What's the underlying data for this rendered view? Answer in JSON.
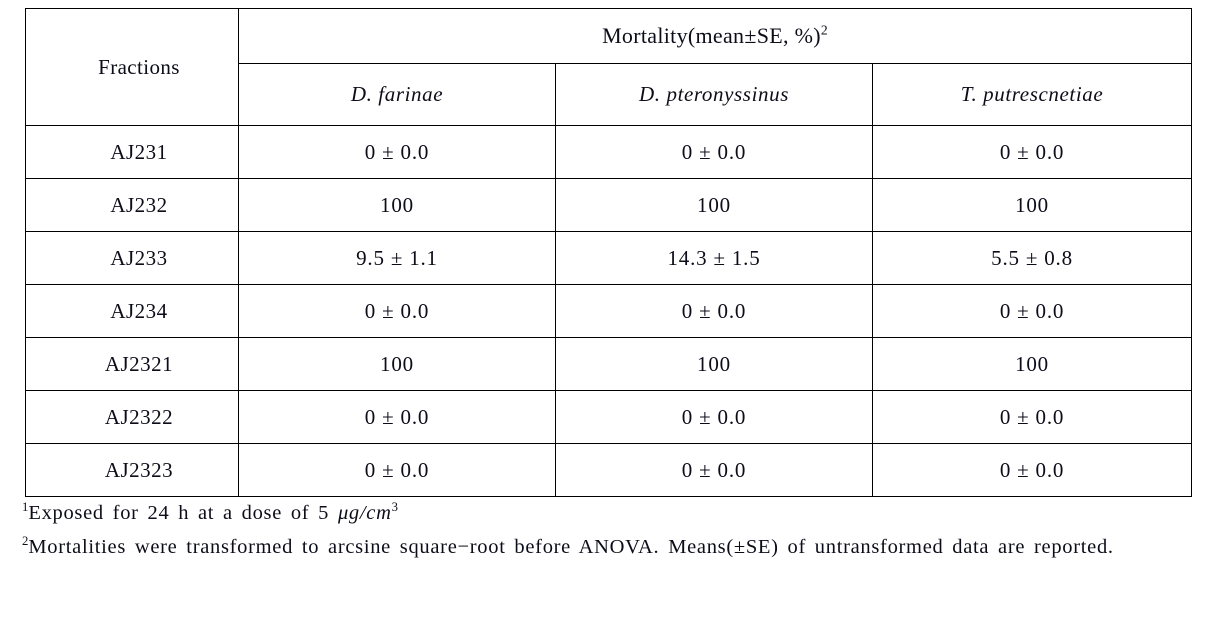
{
  "table": {
    "header": {
      "fractions_label": "Fractions",
      "mortality_label": "Mortality(mean±SE, %)",
      "mortality_superscript": "2",
      "species": [
        "D. farinae",
        "D. pteronyssinus",
        "T. putrescnetiae"
      ]
    },
    "rows": [
      {
        "fraction": "AJ231",
        "values": [
          "0 ± 0.0",
          "0 ± 0.0",
          "0 ± 0.0"
        ]
      },
      {
        "fraction": "AJ232",
        "values": [
          "100",
          "100",
          "100"
        ]
      },
      {
        "fraction": "AJ233",
        "values": [
          "9.5 ± 1.1",
          "14.3 ± 1.5",
          "5.5 ± 0.8"
        ]
      },
      {
        "fraction": "AJ234",
        "values": [
          "0 ± 0.0",
          "0 ± 0.0",
          "0 ± 0.0"
        ]
      },
      {
        "fraction": "AJ2321",
        "values": [
          "100",
          "100",
          "100"
        ]
      },
      {
        "fraction": "AJ2322",
        "values": [
          "0 ± 0.0",
          "0 ± 0.0",
          "0 ± 0.0"
        ]
      },
      {
        "fraction": "AJ2323",
        "values": [
          "0 ± 0.0",
          "0 ± 0.0",
          "0 ± 0.0"
        ]
      }
    ]
  },
  "footnotes": [
    {
      "marker": "1",
      "text_before_unit": "Exposed for 24 h at a dose of 5 ",
      "unit": "μg/cm",
      "unit_superscript": "3",
      "text_after_unit": ""
    },
    {
      "marker": "2",
      "text": "Mortalities were transformed to arcsine square−root before ANOVA. Means(±SE) of untransformed data are reported."
    }
  ]
}
